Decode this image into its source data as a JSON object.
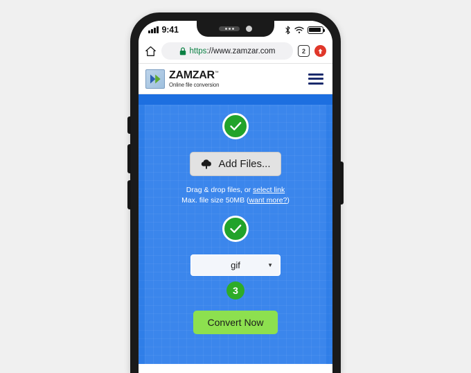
{
  "device": {
    "status_bar": {
      "time": "9:41",
      "signal_icon": "cellular-signal-icon",
      "bluetooth_icon": "bluetooth-icon",
      "wifi_icon": "wifi-icon",
      "battery_icon": "battery-icon"
    },
    "notch": {
      "speaker_icon": "earpiece-speaker-icon",
      "camera_icon": "front-camera-icon"
    },
    "buttons": {
      "silent_switch": "silent-switch",
      "volume_up": "volume-up-button",
      "volume_down": "volume-down-button",
      "power": "power-button"
    }
  },
  "browser": {
    "home_icon": "home-icon",
    "lock_icon": "lock-icon",
    "url_scheme": "https",
    "url_rest": "://www.zamzar.com",
    "url_full": "https://www.zamzar.com",
    "tab_count": "2",
    "share_icon": "share-up-arrow-icon"
  },
  "site": {
    "logo_name": "ZAMZAR",
    "logo_tm": "™",
    "logo_tagline": "Online file conversion",
    "logo_mark_icon": "double-chevron-logo-icon",
    "menu_icon": "hamburger-menu-icon"
  },
  "steps": {
    "step1": {
      "status_icon": "green-check-circle-icon",
      "check_glyph": "✓"
    },
    "step2": {
      "status_icon": "green-check-circle-icon",
      "check_glyph": "✓"
    },
    "step3": {
      "number": "3"
    }
  },
  "upload": {
    "add_files_label": "Add Files...",
    "add_files_icon": "cloud-upload-icon",
    "drag_prefix": "Drag & drop files, or ",
    "select_link_label": "select link",
    "max_size_text": "Max. file size 50MB ",
    "want_more_open": "(",
    "want_more_label": "want more?",
    "want_more_close": ")"
  },
  "format": {
    "selected_value": "gif",
    "arrow_icon": "chevron-down-icon",
    "options": [
      "gif"
    ]
  },
  "convert": {
    "label": "Convert Now"
  },
  "colors": {
    "page_background": "#f0f0f0",
    "phone_body": "#1a1a1a",
    "content_blue": "#2f7ee8",
    "panel_blue": "#3b86ec",
    "strip_blue": "#1d6fe0",
    "check_green": "#22a32b",
    "step_green": "#2eac27",
    "convert_green": "#8de04f",
    "url_secure_green": "#0b8043",
    "share_red": "#e0372a",
    "menu_navy": "#1a2a6c"
  }
}
